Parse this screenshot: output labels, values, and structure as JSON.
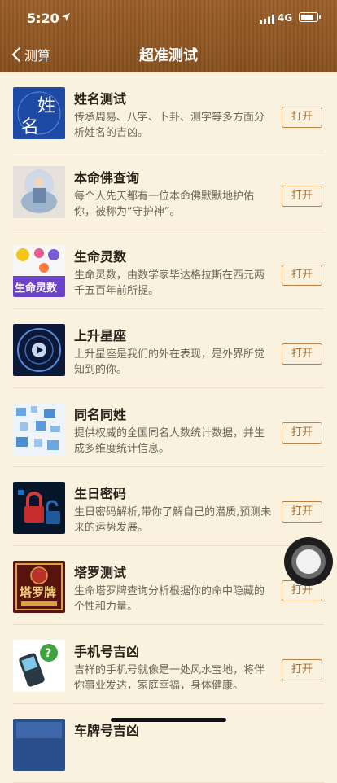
{
  "status": {
    "time": "5:20",
    "network": "4G"
  },
  "nav": {
    "back_label": "测算",
    "title": "超准测试"
  },
  "items": [
    {
      "name": "姓名测试",
      "desc": "传承周易、八字、卜卦、测字等多方面分析姓名的吉凶。",
      "button": "打开"
    },
    {
      "name": "本命佛查询",
      "desc": "每个人先天都有一位本命佛默默地护佑你，被称为“守护神”。",
      "button": "打开"
    },
    {
      "name": "生命灵数",
      "desc": "生命灵数，由数学家毕达格拉斯在西元两千五百年前所提。",
      "button": "打开"
    },
    {
      "name": "上升星座",
      "desc": "上升星座是我们的外在表现，是外界所觉知到的你。",
      "button": "打开"
    },
    {
      "name": "同名同姓",
      "desc": "提供权威的全国同名人数统计数据，并生成多维度统计信息。",
      "button": "打开"
    },
    {
      "name": "生日密码",
      "desc": "生日密码解析,带你了解自己的潜质,预测未来的运势发展。",
      "button": "打开"
    },
    {
      "name": "塔罗测试",
      "desc": "生命塔罗牌查询分析根据你的命中隐藏的个性和力量。",
      "button": "打开"
    },
    {
      "name": "手机号吉凶",
      "desc": "吉祥的手机号就像是一处风水宝地，将伴你事业发达，家庭幸福，身体健康。",
      "button": "打开"
    },
    {
      "name": "车牌号吉凶",
      "desc": "",
      "button": ""
    }
  ],
  "thumb_text": {
    "xingming_1": "姓",
    "xingming_2": "名",
    "lingshu": "生命灵数",
    "taluo": "塔罗牌"
  }
}
